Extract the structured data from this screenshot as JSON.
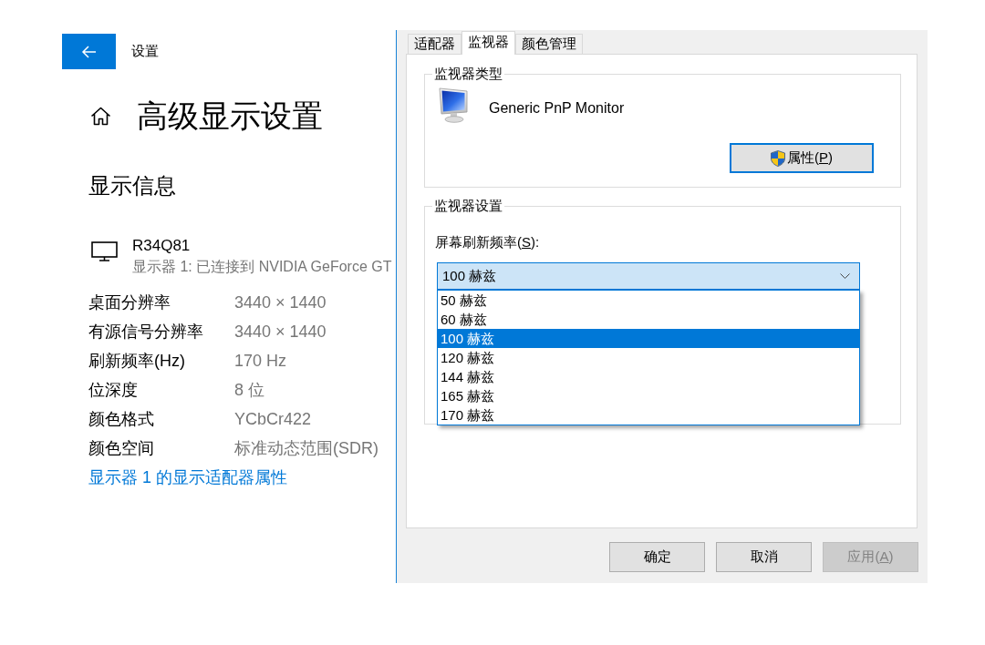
{
  "settings": {
    "app_title": "设置",
    "page_title": "高级显示设置",
    "section_title": "显示信息",
    "display": {
      "name": "R34Q81",
      "description": "显示器 1: 已连接到 NVIDIA GeForce GT"
    },
    "info_rows": [
      {
        "label": "桌面分辨率",
        "value": "3440 × 1440"
      },
      {
        "label": "有源信号分辨率",
        "value": "3440 × 1440"
      },
      {
        "label": "刷新频率(Hz)",
        "value": "170 Hz"
      },
      {
        "label": "位深度",
        "value": "8 位"
      },
      {
        "label": "颜色格式",
        "value": "YCbCr422"
      },
      {
        "label": "颜色空间",
        "value": "标准动态范围(SDR)"
      }
    ],
    "adapter_link": "显示器 1 的显示适配器属性"
  },
  "dialog": {
    "tabs": [
      {
        "label": "适配器",
        "selected": false
      },
      {
        "label": "监视器",
        "selected": true
      },
      {
        "label": "颜色管理",
        "selected": false
      }
    ],
    "monitor_type": {
      "title": "监视器类型",
      "monitor_name": "Generic PnP Monitor",
      "properties_button": {
        "label": "属性(",
        "accelerator": "P",
        "label_end": ")",
        "focused": true
      }
    },
    "monitor_settings": {
      "title": "监视器设置",
      "refresh_label": {
        "label": "屏幕刷新频率(",
        "accelerator": "S",
        "label_end": "):"
      },
      "refresh_rate": {
        "value": "100 赫兹",
        "expanded": true,
        "options": [
          {
            "label": "50 赫兹",
            "selected": false
          },
          {
            "label": "60 赫兹",
            "selected": false
          },
          {
            "label": "100 赫兹",
            "selected": true
          },
          {
            "label": "120 赫兹",
            "selected": false
          },
          {
            "label": "144 赫兹",
            "selected": false
          },
          {
            "label": "165 赫兹",
            "selected": false
          },
          {
            "label": "170 赫兹",
            "selected": false
          }
        ]
      }
    },
    "buttons": [
      {
        "label": "确定",
        "disabled": false
      },
      {
        "label": "取消",
        "disabled": false
      },
      {
        "label": "应用(",
        "accelerator": "A",
        "label_end": ")",
        "disabled": true
      }
    ]
  }
}
